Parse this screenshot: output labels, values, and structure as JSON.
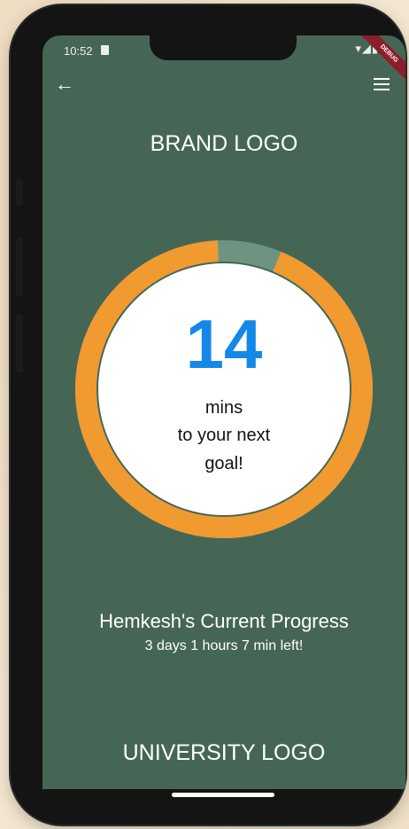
{
  "status_bar": {
    "time": "10:52",
    "icons": "▾◢▮",
    "debug_banner": "DEBUG"
  },
  "toolbar": {
    "back_icon": "arrow-left-icon",
    "menu_icon": "hamburger-menu-icon"
  },
  "header": {
    "brand_logo": "BRAND LOGO"
  },
  "goal": {
    "minutes": "14",
    "line1": "mins",
    "line2": "to your next",
    "line3": "goal!",
    "progress_fraction": 0.93
  },
  "progress": {
    "title": "Hemkesh's Current Progress",
    "time_left": "3 days 1 hours 7 min left!"
  },
  "footer": {
    "university_logo": "UNIVERSITY LOGO"
  },
  "colors": {
    "screen_bg": "#466655",
    "ring_progress": "#F19A30",
    "ring_track": "#6F9381",
    "number": "#1488E8"
  }
}
